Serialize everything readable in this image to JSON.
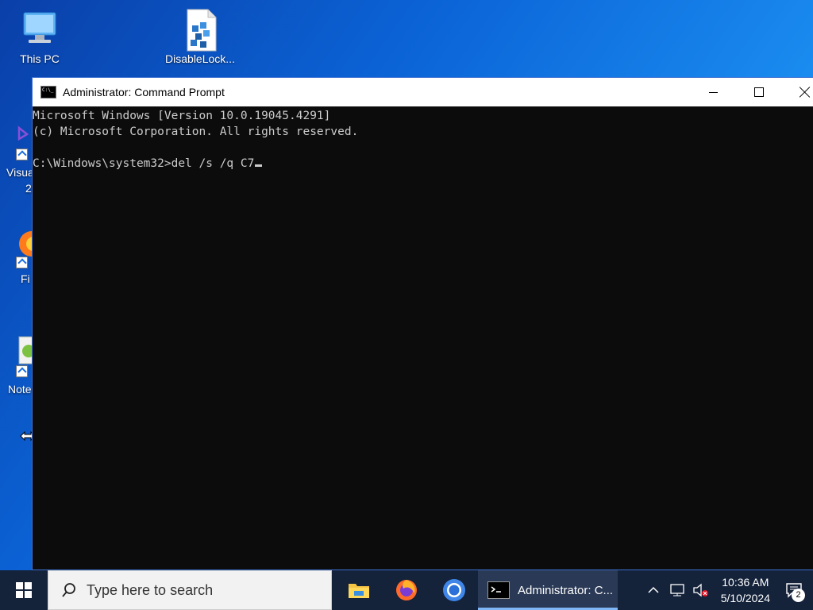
{
  "desktop": {
    "icons": [
      {
        "label": "This PC",
        "icon": "computer-icon"
      },
      {
        "label": "DisableLock...",
        "icon": "registry-file-icon"
      }
    ],
    "partial_icons": [
      {
        "label": "Visua",
        "sub": "2",
        "icon": "visual-studio-icon"
      },
      {
        "label": "Fi",
        "icon": "firefox-icon"
      },
      {
        "label": "Note",
        "icon": "notepadpp-icon"
      }
    ]
  },
  "window": {
    "title": "Administrator: Command Prompt",
    "console_lines": [
      "Microsoft Windows [Version 10.0.19045.4291]",
      "(c) Microsoft Corporation. All rights reserved.",
      "",
      "C:\\Windows\\system32>del /s /q C7"
    ]
  },
  "taskbar": {
    "search_placeholder": "Type here to search",
    "active_app_label": "Administrator: C...",
    "pinned": [
      "file-explorer-icon",
      "firefox-icon",
      "chrome-icon"
    ],
    "clock_time": "10:36 AM",
    "clock_date": "5/10/2024",
    "notification_count": "2"
  },
  "colors": {
    "console_bg": "#0c0c0c",
    "console_fg": "#cccccc",
    "taskbar_bg": "#14223a"
  }
}
